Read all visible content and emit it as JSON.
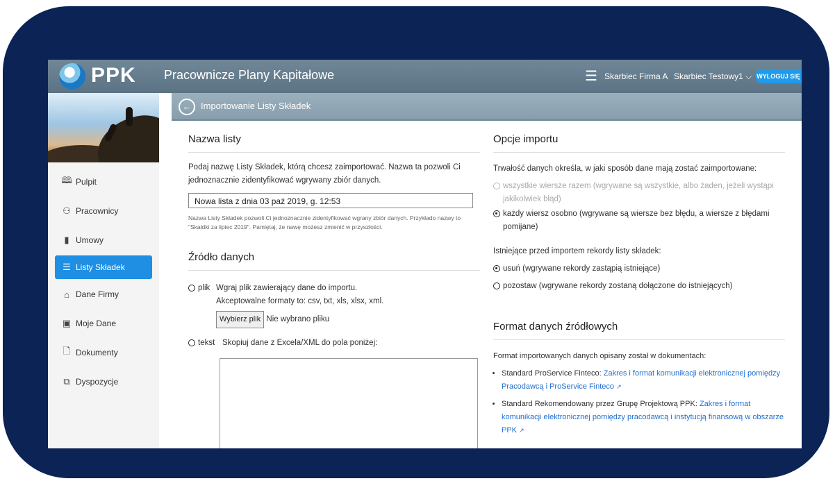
{
  "topbar": {
    "logo_text": "PPK",
    "title": "Pracownicze Plany Kapitałowe",
    "menu_icon": "hamburger-icon",
    "firm": "Skarbiec Firma A",
    "user": "Skarbiec Testowy1 ⌵",
    "logout": "WYLOGUJ SIĘ"
  },
  "sidebar": {
    "items": [
      {
        "label": "Pulpit",
        "icon": "book-icon",
        "glyph": "🕮"
      },
      {
        "label": "Pracownicy",
        "icon": "users-icon",
        "glyph": "⚇"
      },
      {
        "label": "Umowy",
        "icon": "files-icon",
        "glyph": "▮"
      },
      {
        "label": "Listy Składek",
        "icon": "list-icon",
        "glyph": "☰",
        "active": true
      },
      {
        "label": "Dane Firmy",
        "icon": "home-icon",
        "glyph": "⌂"
      },
      {
        "label": "Moje Dane",
        "icon": "id-card-icon",
        "glyph": "▣"
      },
      {
        "label": "Dokumenty",
        "icon": "document-icon",
        "glyph": "🗋"
      },
      {
        "label": "Dyspozycje",
        "icon": "documents-icon",
        "glyph": "⧉"
      }
    ]
  },
  "header": {
    "back_icon": "back-arrow-icon",
    "title": "Importowanie Listy Składek"
  },
  "name_section": {
    "heading": "Nazwa listy",
    "description": "Podaj nazwę Listy Składek, którą chcesz zaimportować. Nazwa ta pozwoli Ci jednoznacznie zidentyfikować wgrywany zbiór danych.",
    "input_value": "Nowa lista z dnia 03 paź 2019, g. 12:53",
    "hint": "Nazwa Listy Składek pozwoli Ci jednoznacznie zidentyfikować wgrany zbiór danych. Przykłado nazwy to \"Skałdki za lipiec 2019\". Pamiętaj, że nawę możesz zmienić w przyszłości."
  },
  "source_section": {
    "heading": "Źródło danych",
    "file_option_label": "plik",
    "file_line1": "Wgraj plik zawierający dane do importu.",
    "file_line2": "Akceptowalne formaty to: csv, txt, xls, xlsx, xml.",
    "choose_file_button": "Wybierz plik",
    "no_file_text": "Nie wybrano pliku",
    "text_option_label": "tekst",
    "text_instruction": "Skopiuj dane z Excela/XML do pola poniżej:"
  },
  "import_options": {
    "heading": "Opcje importu",
    "description": "Trwałość danych określa, w jaki sposób dane mają zostać zaimportowane:",
    "option_all": "wszystkie wiersze razem (wgrywane są wszystkie, albo żaden, jeżeli wystąpi jakikolwiek błąd)",
    "option_each": "każdy wiersz osobno (wgrywane są wiersze bez błędu, a wiersze z błędami pomijane)",
    "existing_label": "Istniejące przed importem rekordy listy składek:",
    "option_delete": "usuń (wgrywane rekordy zastąpią istniejące)",
    "option_keep": "pozostaw (wgrywane rekordy zostaną dołączone do istniejących)"
  },
  "format_section": {
    "heading": "Format danych źródłowych",
    "description": "Format importowanych danych opisany został w dokumentach:",
    "item1_prefix": "Standard ProService Finteco: ",
    "item1_link": "Zakres i format komunikacji elektronicznej pomiędzy Pracodawcą i ProService Finteco",
    "item2_prefix": "Standard Rekomendowany przez Grupę Projektową PPK: ",
    "item2_link": "Zakres i format komunikacji elektronicznej pomiędzy pracodawcą i instytucją finansową w obszarze PPK",
    "external_icon": "external-link-icon"
  }
}
